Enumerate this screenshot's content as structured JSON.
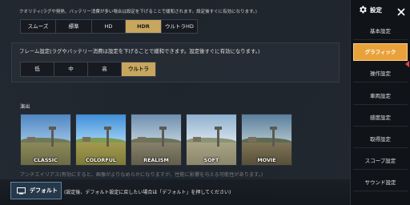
{
  "quality": {
    "description": "クオリティ(ラグや発熱、バッテリー消費が多い場合は設定を下げることで緩和されます。設定後すぐに有効になります。)",
    "options": [
      "スムーズ",
      "標準",
      "HD",
      "HDR",
      "ウルトラHD"
    ],
    "selected": "HDR"
  },
  "frame_rate": {
    "description": "フレーム設定(ラグやバッテリー消費は設定を下げることで緩和できます。設定後すぐに有効になります。)",
    "options": [
      "低",
      "中",
      "高",
      "ウルトラ"
    ],
    "selected": "ウルトラ"
  },
  "style": {
    "label": "演出",
    "presets": [
      "CLASSIC",
      "COLORFUL",
      "REALISM",
      "SOFT",
      "MOVIE"
    ]
  },
  "cut_off_text": "アンチエイリアス(有効にすると、画像がよりなめらかになりますが、性能に影響を与える可能性があります。)",
  "footer": {
    "default_label": "デフォルト",
    "default_note": "(設定後、デフォルト設定に戻したい場合は「デフォルト」を押してください)"
  },
  "sidebar": {
    "title": "設定",
    "items": [
      "基本設定",
      "グラフィック",
      "操作設定",
      "車両設定",
      "感度設定",
      "取得設定",
      "スコープ設定",
      "サウンド設定"
    ],
    "selected": "グラフィック"
  },
  "colors": {
    "accent_gold": "#c7a65e",
    "sidebar_selected": "#e9a23b",
    "default_button": "#26384a"
  },
  "icons": {
    "settings": "gear-icon",
    "close": "close-icon",
    "default": "monitor-icon"
  }
}
